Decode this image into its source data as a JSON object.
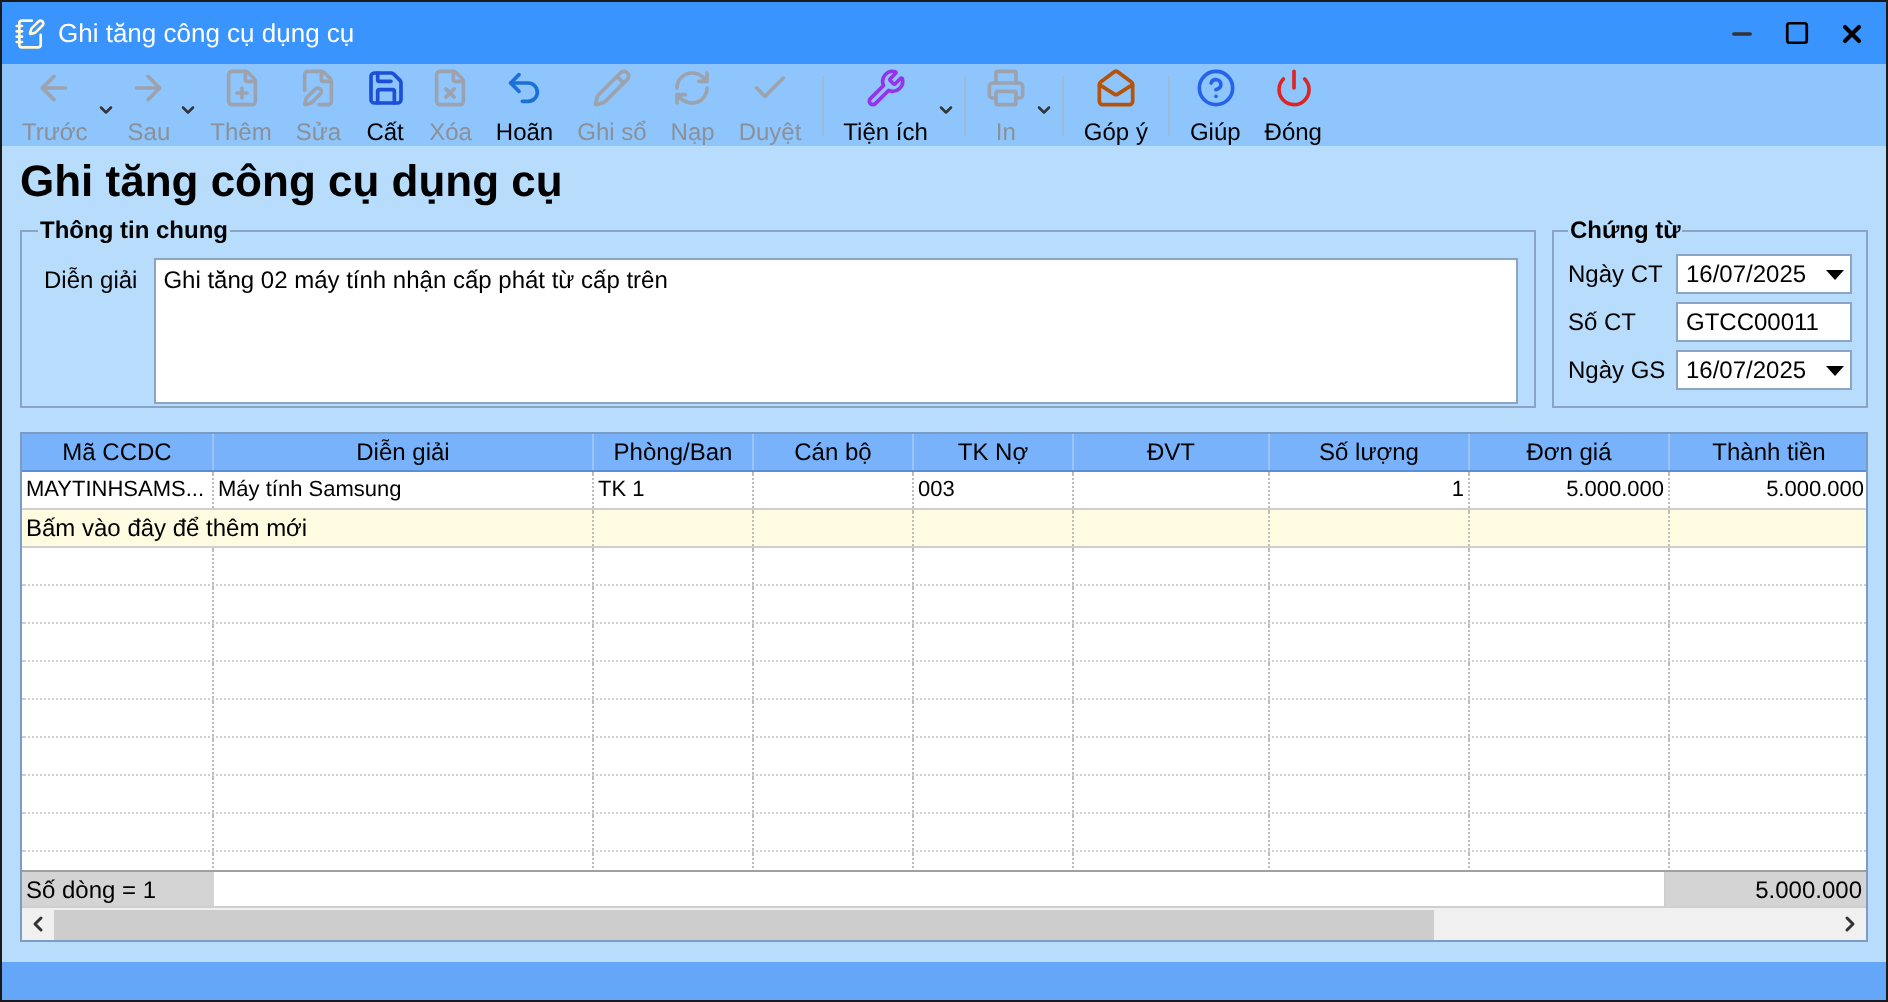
{
  "window": {
    "title": "Ghi tăng công cụ dụng cụ"
  },
  "toolbar": [
    {
      "kind": "button",
      "label": "Trước",
      "disabled": true,
      "dropdown": true
    },
    {
      "kind": "button",
      "label": "Sau",
      "disabled": true,
      "dropdown": true
    },
    {
      "kind": "button",
      "label": "Thêm",
      "disabled": true,
      "dropdown": false
    },
    {
      "kind": "button",
      "label": "Sửa",
      "disabled": true,
      "dropdown": false
    },
    {
      "kind": "button",
      "label": "Cất",
      "disabled": false,
      "dropdown": false
    },
    {
      "kind": "button",
      "label": "Xóa",
      "disabled": true,
      "dropdown": false
    },
    {
      "kind": "button",
      "label": "Hoãn",
      "disabled": false,
      "dropdown": false
    },
    {
      "kind": "button",
      "label": "Ghi sổ",
      "disabled": true,
      "dropdown": false
    },
    {
      "kind": "button",
      "label": "Nạp",
      "disabled": true,
      "dropdown": false
    },
    {
      "kind": "button",
      "label": "Duyệt",
      "disabled": true,
      "dropdown": false
    },
    {
      "kind": "separator"
    },
    {
      "kind": "button",
      "label": "Tiện ích",
      "disabled": false,
      "dropdown": true
    },
    {
      "kind": "separator"
    },
    {
      "kind": "button",
      "label": "In",
      "disabled": true,
      "dropdown": true
    },
    {
      "kind": "separator"
    },
    {
      "kind": "button",
      "label": "Góp ý",
      "disabled": false,
      "dropdown": false
    },
    {
      "kind": "separator"
    },
    {
      "kind": "button",
      "label": "Giúp",
      "disabled": false,
      "dropdown": false
    },
    {
      "kind": "button",
      "label": "Đóng",
      "disabled": false,
      "dropdown": false
    }
  ],
  "heading": "Ghi tăng công cụ dụng cụ",
  "general": {
    "title": "Thông tin chung",
    "label": "Diễn giải",
    "value": "Ghi tăng 02 máy tính nhận cấp phát từ cấp trên"
  },
  "voucher": {
    "title": "Chứng từ",
    "fields": [
      {
        "kind": "date",
        "label": "Ngày CT",
        "value": "16/07/2025"
      },
      {
        "kind": "text",
        "label": "Số CT",
        "value": "GTCC00011"
      },
      {
        "kind": "date",
        "label": "Ngày GS",
        "value": "16/07/2025"
      }
    ]
  },
  "table": {
    "columns": [
      {
        "label": "Mã CCDC",
        "kind": "text"
      },
      {
        "label": "Diễn giải",
        "kind": "text"
      },
      {
        "label": "Phòng/Ban",
        "kind": "text"
      },
      {
        "label": "Cán bộ",
        "kind": "text"
      },
      {
        "label": "TK Nợ",
        "kind": "text"
      },
      {
        "label": "ĐVT",
        "kind": "text"
      },
      {
        "label": "Số lượng",
        "kind": "number"
      },
      {
        "label": "Đơn giá",
        "kind": "number"
      },
      {
        "label": "Thành tiền",
        "kind": "number"
      }
    ],
    "rows": [
      {
        "cells": [
          "MAYTINHSAMS...",
          "Máy tính Samsung",
          "TK 1",
          "",
          "003",
          "",
          "1",
          "5.000.000",
          "5.000.000"
        ]
      }
    ],
    "new_row_hint": "Bấm vào đây để thêm mới",
    "footer": {
      "count": "Số dòng = 1",
      "total": "5.000.000"
    }
  }
}
